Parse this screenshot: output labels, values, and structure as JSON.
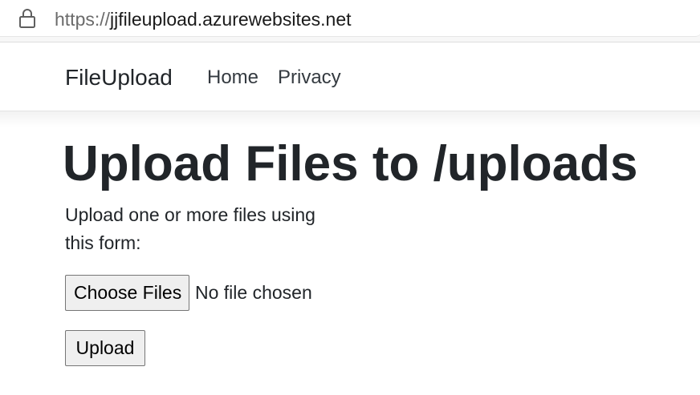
{
  "browser": {
    "url_scheme": "https://",
    "url_host": "jjfileupload.azurewebsites.net",
    "lock_icon": "lock-icon"
  },
  "navbar": {
    "brand": "FileUpload",
    "links": [
      {
        "label": "Home"
      },
      {
        "label": "Privacy"
      }
    ]
  },
  "main": {
    "title": "Upload Files to /uploads",
    "intro": "Upload one or more files using this form:",
    "file_input": {
      "button_label": "Choose Files",
      "status": "No file chosen"
    },
    "upload_button_label": "Upload"
  },
  "colors": {
    "text": "#212529",
    "nav_link": "#343a40",
    "button_bg": "#efefef",
    "button_border": "#767676"
  }
}
